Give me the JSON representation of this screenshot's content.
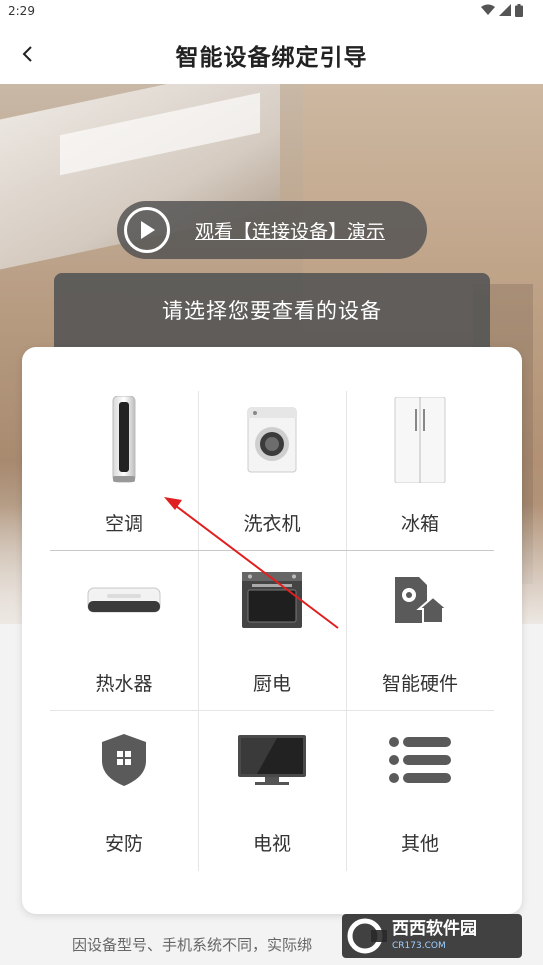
{
  "status_bar": {
    "time": "2:29"
  },
  "nav": {
    "title": "智能设备绑定引导",
    "back_icon": "chevron-left-icon"
  },
  "video": {
    "label": "观看【连接设备】演示",
    "icon": "play-icon"
  },
  "select_header": "请选择您要查看的设备",
  "devices": [
    {
      "label": "空调",
      "icon": "air-conditioner-icon"
    },
    {
      "label": "洗衣机",
      "icon": "washing-machine-icon"
    },
    {
      "label": "冰箱",
      "icon": "refrigerator-icon"
    },
    {
      "label": "热水器",
      "icon": "water-heater-icon"
    },
    {
      "label": "厨电",
      "icon": "oven-icon"
    },
    {
      "label": "智能硬件",
      "icon": "smart-hardware-icon"
    },
    {
      "label": "安防",
      "icon": "security-shield-icon"
    },
    {
      "label": "电视",
      "icon": "tv-icon"
    },
    {
      "label": "其他",
      "icon": "list-icon"
    }
  ],
  "footer_note": "因设备型号、手机系统不同，实际绑",
  "watermark": {
    "name": "西西软件园",
    "url": "CR173.COM"
  },
  "colors": {
    "arrow": "#e02020",
    "header_bg": "#555555",
    "card_bg": "#ffffff"
  }
}
